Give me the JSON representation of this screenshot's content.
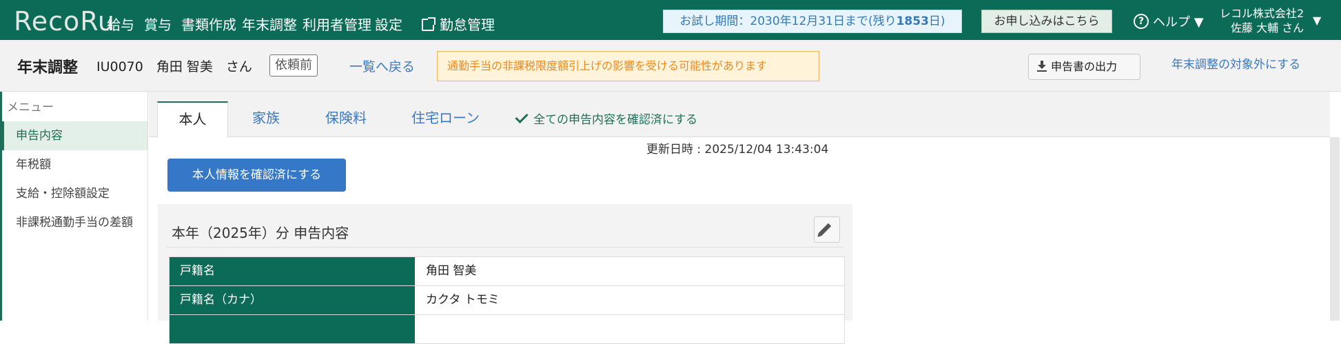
{
  "brand": "RecoRu",
  "nav": {
    "items": [
      "給与",
      "賞与",
      "書類作成",
      "年末調整",
      "利用者管理",
      "設定"
    ],
    "attendance": "勤怠管理",
    "trial_prefix": "お試し期間：2030年12月31日まで(残り",
    "trial_days": "1853",
    "trial_suffix": "日)",
    "apply": "お申し込みはこちら",
    "help": "ヘルプ ▼",
    "company": "レコル株式会社2",
    "user": "佐藤 大輔 さん",
    "user_caret": "▼"
  },
  "header": {
    "title": "年末調整",
    "employee": "IU0070　角田 智美　さん",
    "status": "依頼前",
    "back_link": "一覧へ戻る",
    "warning": "通勤手当の非課税限度額引上げの影響を受ける可能性があります",
    "export_button": "申告書の出力",
    "exclude_link": "年末調整の対象外にする"
  },
  "sidebar": {
    "heading": "メニュー",
    "items": [
      "申告内容",
      "年税額",
      "支給・控除額設定",
      "非課税通勤手当の差額"
    ]
  },
  "tabs": {
    "items": [
      "本人",
      "家族",
      "保険料",
      "住宅ローン"
    ],
    "confirm_all": "全ての申告内容を確認済にする"
  },
  "content": {
    "updated": "更新日時 : 2025/12/04 13:43:04",
    "confirm_button": "本人情報を確認済にする",
    "card_title": "本年（2025年）分 申告内容",
    "rows": [
      {
        "label": "戸籍名",
        "value": "角田 智美"
      },
      {
        "label": "戸籍名（カナ）",
        "value": "カクタ トモミ"
      },
      {
        "label": "",
        "value": ""
      }
    ]
  },
  "colors": {
    "brand_green": "#0b6b56",
    "link_blue": "#3a78c2",
    "button_blue": "#3578c8",
    "warning_orange": "#ee8a1f"
  }
}
